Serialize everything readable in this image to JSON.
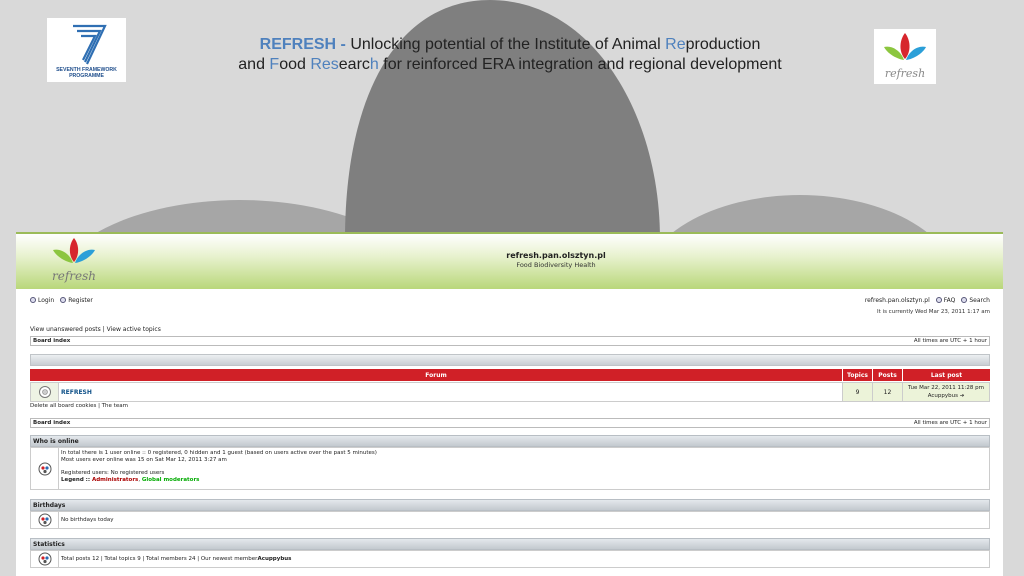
{
  "slide": {
    "title_line1": [
      {
        "text": "REFRESH - ",
        "style": "hl"
      },
      {
        "text": "Unlocking potential of the Institute of Animal ",
        "style": ""
      },
      {
        "text": "Re",
        "style": "hl2"
      },
      {
        "text": "production",
        "style": ""
      }
    ],
    "title_line2": [
      {
        "text": "and ",
        "style": ""
      },
      {
        "text": "F",
        "style": "hl2"
      },
      {
        "text": "ood ",
        "style": ""
      },
      {
        "text": "Res",
        "style": "hl2"
      },
      {
        "text": "earc",
        "style": ""
      },
      {
        "text": "h",
        "style": "hl2"
      },
      {
        "text": " for reinforced ERA integration and regional development",
        "style": ""
      }
    ],
    "fp7_logo_text": "SEVENTH FRAMEWORK PROGRAMME",
    "refresh_logo_text": "refresh"
  },
  "colors": {
    "accent_blue": "#4f81bd",
    "forum_red": "#d02027",
    "header_green": "#b9d77a",
    "admin_red": "#aa0000",
    "gmod_green": "#00aa00"
  },
  "forum": {
    "logo_text": "refresh",
    "site_name": "refresh.pan.olsztyn.pl",
    "site_desc": "Food Biodiversity Health",
    "nav": {
      "login": "Login",
      "register": "Register",
      "home": "refresh.pan.olsztyn.pl",
      "faq": "FAQ",
      "search": "Search"
    },
    "current_time": "It is currently Wed Mar 23, 2011 1:17 am",
    "links": "View unanswered posts | View active topics",
    "breadcrumb": "Board index",
    "timezone": "All times are UTC + 1 hour",
    "table": {
      "headers": [
        "Forum",
        "Topics",
        "Posts",
        "Last post"
      ],
      "row": {
        "forum": "REFRESH",
        "topics": "9",
        "posts": "12",
        "last_post_date": "Tue Mar 22, 2011 11:28 pm",
        "last_post_user": "Acuppybus"
      }
    },
    "footer_links": "Delete all board cookies | The team",
    "who_online": {
      "title": "Who is online",
      "line1": "In total there is 1 user online :: 0 registered, 0 hidden and 1 guest (based on users active over the past 5 minutes)",
      "line2": "Most users ever online was 15 on Sat Mar 12, 2011 3:27 am",
      "line3": "Registered users: No registered users",
      "legend_label": "Legend :: ",
      "legend_admin": "Administrators",
      "legend_sep": ", ",
      "legend_gmod": "Global moderators"
    },
    "birthdays": {
      "title": "Birthdays",
      "text": "No birthdays today"
    },
    "statistics": {
      "title": "Statistics",
      "text": "Total posts 12 | Total topics 9 | Total members 24 | Our newest member ",
      "newest": "Acuppybus"
    }
  }
}
